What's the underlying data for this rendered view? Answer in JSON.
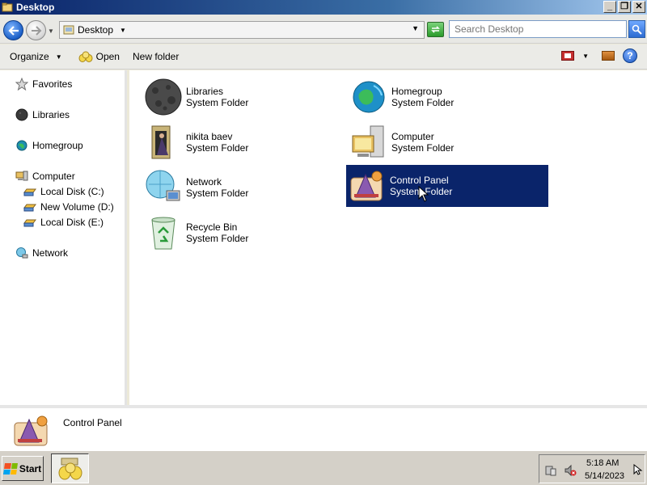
{
  "window": {
    "title": "Desktop",
    "buttons": {
      "minimize": "_",
      "maximize": "❐",
      "close": "✕"
    }
  },
  "address": {
    "location": "Desktop",
    "search_placeholder": "Search Desktop"
  },
  "toolbar": {
    "organize": "Organize",
    "open": "Open",
    "new_folder": "New folder",
    "help": "?"
  },
  "nav": {
    "favorites": "Favorites",
    "libraries": "Libraries",
    "homegroup": "Homegroup",
    "computer": "Computer",
    "drives": [
      {
        "label": "Local Disk (C:)"
      },
      {
        "label": "New Volume (D:)"
      },
      {
        "label": "Local Disk (E:)"
      }
    ],
    "network": "Network"
  },
  "items": [
    {
      "name": "Libraries",
      "type": "System Folder",
      "icon": "libraries-icon"
    },
    {
      "name": "Homegroup",
      "type": "System Folder",
      "icon": "homegroup-icon"
    },
    {
      "name": "nikita baev",
      "type": "System Folder",
      "icon": "user-folder-icon"
    },
    {
      "name": "Computer",
      "type": "System Folder",
      "icon": "computer-icon"
    },
    {
      "name": "Network",
      "type": "System Folder",
      "icon": "network-icon"
    },
    {
      "name": "Control Panel",
      "type": "System Folder",
      "icon": "control-panel-icon",
      "selected": true
    },
    {
      "name": "Recycle Bin",
      "type": "System Folder",
      "icon": "recycle-bin-icon"
    }
  ],
  "details": {
    "name": "Control Panel"
  },
  "taskbar": {
    "start": "Start",
    "time": "5:18 AM",
    "date": "5/14/2023"
  },
  "colors": {
    "selection": "#0a246a",
    "titlebar_start": "#0a246a",
    "titlebar_end": "#a6caf0",
    "taskbar": "#d4d0c8"
  }
}
